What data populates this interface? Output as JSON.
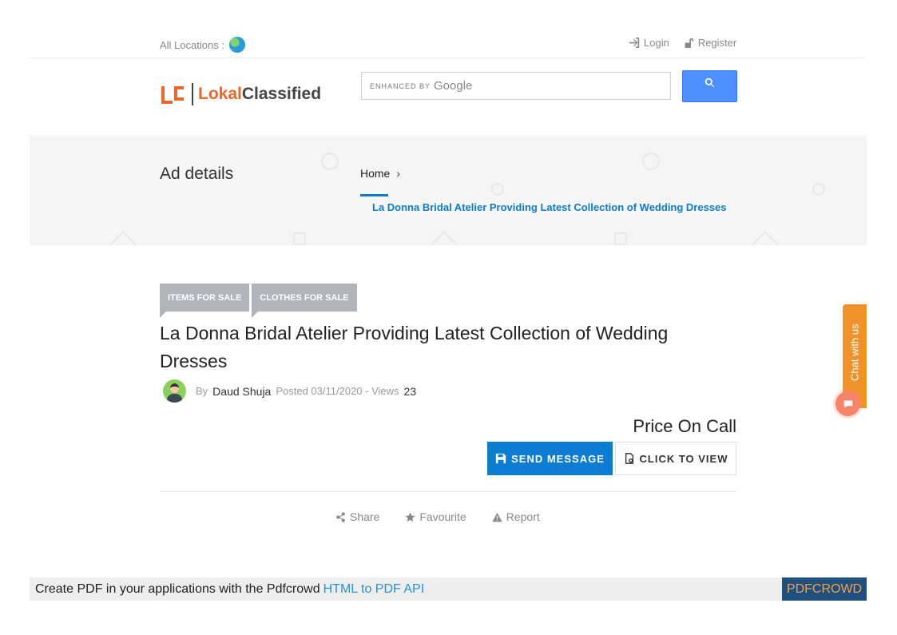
{
  "topbar": {
    "locations_label": "All Locations :",
    "login_label": "Login",
    "register_label": "Register"
  },
  "header": {
    "logo_part1": "Lokal",
    "logo_part2": "Classified",
    "search_enhanced_by": "ENHANCED BY",
    "search_google": "Google"
  },
  "banner": {
    "page_title": "Ad details",
    "breadcrumb_home": "Home",
    "breadcrumb_current": "La Donna Bridal Atelier Providing Latest Collection of Wedding Dresses"
  },
  "ad": {
    "tags": [
      "ITEMS FOR SALE",
      "CLOTHES FOR SALE"
    ],
    "title": "La Donna Bridal Atelier Providing Latest Collection of Wedding Dresses",
    "by_label": "By",
    "author": "Daud Shuja",
    "posted_label": "Posted 03/11/2020 - Views",
    "views": "23",
    "price": "Price On Call",
    "send_message_label": "SEND MESSAGE",
    "click_to_view_label": "CLICK TO VIEW",
    "share_label": "Share",
    "favourite_label": "Favourite",
    "report_label": "Report"
  },
  "chat": {
    "label": "Chat with us"
  },
  "pdfcrowd": {
    "text": "Create PDF in your applications with the Pdfcrowd",
    "link_text": "HTML to PDF API",
    "brand": "PDFCROWD"
  },
  "colors": {
    "accent_blue": "#0b7dd0",
    "logo_orange": "#e8672a",
    "chat_orange": "#f0922c",
    "tag_gray": "#b1b5ba"
  }
}
